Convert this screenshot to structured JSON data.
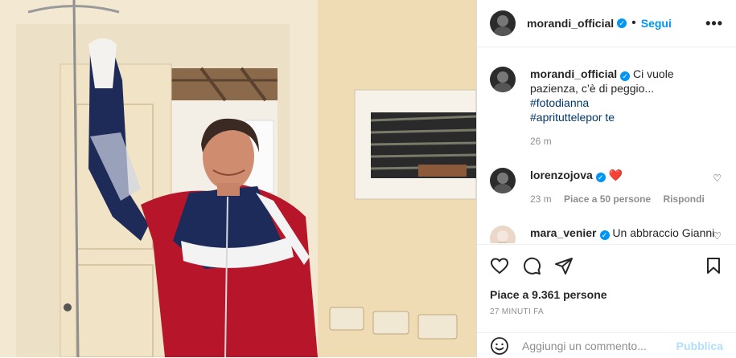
{
  "post": {
    "image_alt": "",
    "author": "morandi_official",
    "follow_label": "Segui",
    "more_label": "•••",
    "caption": {
      "user": "morandi_official",
      "text": "Ci vuole pazienza, c’è di peggio...",
      "hashtags": [
        "#fotodianna",
        "#aprituttelepor te"
      ],
      "time": "26 m"
    },
    "comments": [
      {
        "user": "lorenzojova",
        "text": "❤️",
        "time": "23 m",
        "likes": "Piace a 50 persone",
        "reply": "Rispondi"
      },
      {
        "user": "mara_venier",
        "text": "Un abbraccio Gianni"
      }
    ],
    "likes_text": "Piace a 9.361 persone",
    "posted_ago": "27 MINUTI FA",
    "comment_placeholder": "Aggiungi un commento...",
    "publish_label": "Pubblica"
  }
}
